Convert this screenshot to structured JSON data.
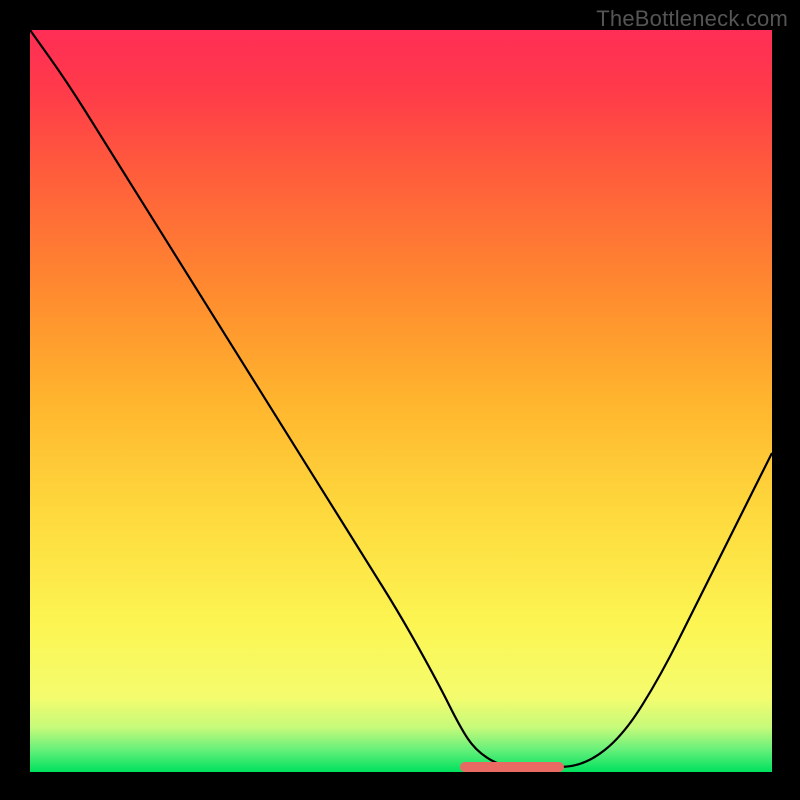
{
  "watermark": "TheBottleneck.com",
  "chart_data": {
    "type": "line",
    "title": "",
    "xlabel": "",
    "ylabel": "",
    "xlim": [
      0,
      100
    ],
    "ylim": [
      0,
      100
    ],
    "x": [
      0,
      5,
      10,
      15,
      20,
      25,
      30,
      35,
      40,
      45,
      50,
      55,
      58,
      60,
      63,
      66,
      70,
      75,
      80,
      85,
      90,
      95,
      100
    ],
    "values": [
      100,
      93,
      85,
      77,
      69,
      61,
      53,
      45,
      37,
      29,
      21,
      12,
      6,
      3,
      1,
      0.5,
      0.5,
      1,
      5,
      13,
      23,
      33,
      43
    ],
    "optimal_zone": {
      "x_start": 58,
      "x_end": 72
    },
    "gradient_stops": [
      {
        "offset": 0.0,
        "color": "#00e15e"
      },
      {
        "offset": 0.03,
        "color": "#66f07a"
      },
      {
        "offset": 0.06,
        "color": "#c6fa7a"
      },
      {
        "offset": 0.1,
        "color": "#f4fc6e"
      },
      {
        "offset": 0.2,
        "color": "#fcf552"
      },
      {
        "offset": 0.35,
        "color": "#fed93d"
      },
      {
        "offset": 0.5,
        "color": "#ffb52e"
      },
      {
        "offset": 0.65,
        "color": "#ff8a2f"
      },
      {
        "offset": 0.8,
        "color": "#ff5f3b"
      },
      {
        "offset": 0.92,
        "color": "#ff3a4a"
      },
      {
        "offset": 1.0,
        "color": "#ff2e56"
      }
    ]
  }
}
